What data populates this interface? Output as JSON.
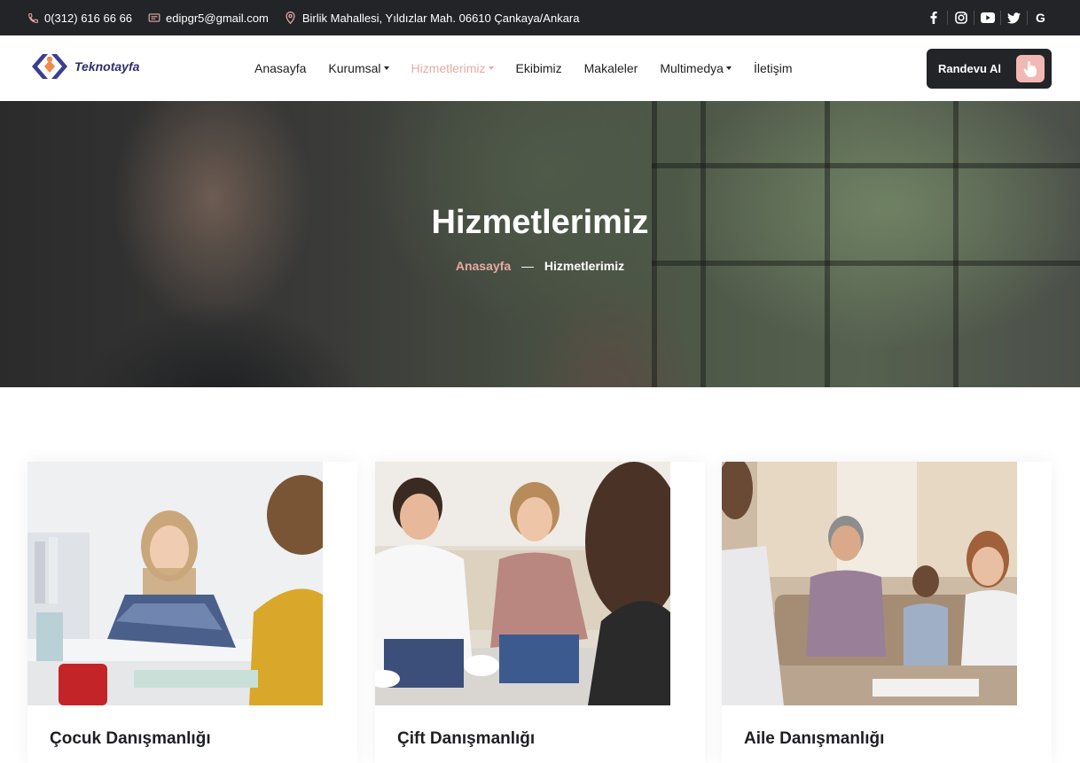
{
  "topbar": {
    "phone": "0(312) 616 66 66",
    "email": "edipgr5@gmail.com",
    "address": "Birlik Mahallesi, Yıldızlar Mah. 06610 Çankaya/Ankara",
    "social": [
      "facebook-icon",
      "instagram-icon",
      "youtube-icon",
      "twitter-icon",
      "google-icon"
    ]
  },
  "header": {
    "logo_text": "Teknotayfa",
    "nav": {
      "home": "Anasayfa",
      "corporate": "Kurumsal",
      "services": "Hizmetlerimiz",
      "team": "Ekibimiz",
      "articles": "Makaleler",
      "multimedia": "Multimedya",
      "contact": "İletişim"
    },
    "cta_label": "Randevu Al"
  },
  "hero": {
    "title": "Hizmetlerimiz",
    "breadcrumb_home": "Anasayfa",
    "breadcrumb_sep": "—",
    "breadcrumb_current": "Hizmetlerimiz"
  },
  "services": [
    {
      "title": "Çocuk Danışmanlığı"
    },
    {
      "title": "Çift Danışmanlığı"
    },
    {
      "title": "Aile Danışmanlığı"
    }
  ],
  "colors": {
    "accent": "#e8a9a4",
    "dark": "#222428"
  }
}
